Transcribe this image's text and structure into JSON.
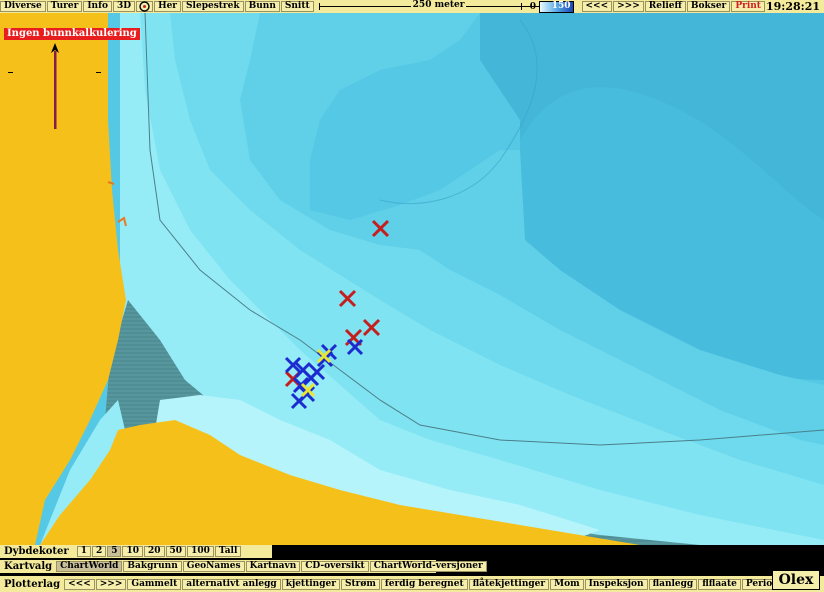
{
  "topbar": {
    "buttons": [
      "Diverse",
      "Turer",
      "Info",
      "3D"
    ],
    "buttons2": [
      "Her",
      "Slepestrek",
      "Bunn",
      "Snitt"
    ],
    "scale_label": "250 meter",
    "depth_min": "0",
    "depth_max": "150",
    "nav_prev": "<<<",
    "nav_next": ">>>",
    "relief": "Relieff",
    "boxes": "Bokser",
    "print": "Print",
    "clock": "19:28:21"
  },
  "map": {
    "warning": "Ingen bunnkalkulering",
    "markers_red": 5,
    "markers_blue": 10,
    "markers_yellow": 2
  },
  "bottom": {
    "depth_label": "Dybdekoter",
    "depth_options": [
      "1",
      "2",
      "5",
      "10",
      "20",
      "50",
      "100",
      "Tall"
    ],
    "depth_selected": "5",
    "chart_label": "Kartvalg",
    "chart_options": [
      "ChartWorld",
      "Bakgrunn",
      "GeoNames",
      "Kartnavn",
      "CD-oversikt",
      "ChartWorld-versjoner"
    ],
    "chart_selected": "ChartWorld",
    "plot_label": "Plotterlag",
    "plot_options": [
      "<<<",
      ">>>",
      "Gammelt",
      "alternativt anlegg",
      "kjettinger",
      "Strøm",
      "ferdig beregnet",
      "flåtekjettinger",
      "Mom",
      "Inspeksjon",
      "flanlegg",
      "flflaate",
      "Periode"
    ],
    "logo": "Olex"
  }
}
